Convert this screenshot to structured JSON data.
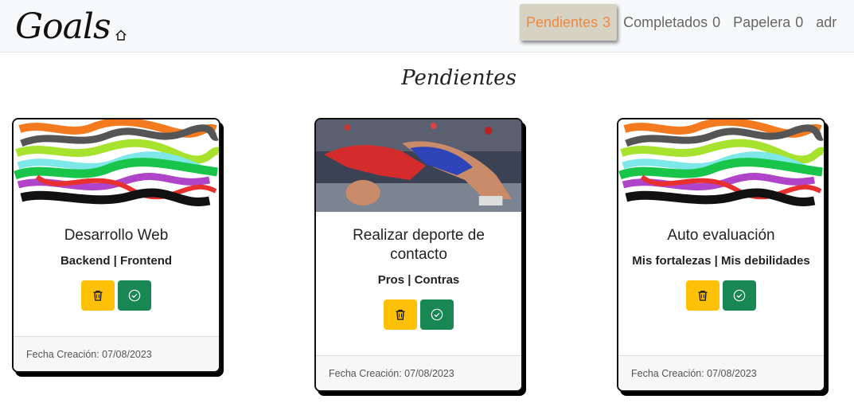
{
  "navbar": {
    "brand": "Goals",
    "links": [
      {
        "label": "Pendientes",
        "count": "3",
        "active": true
      },
      {
        "label": "Completados",
        "count": "0",
        "active": false
      },
      {
        "label": "Papelera",
        "count": "0",
        "active": false
      },
      {
        "label": "adr",
        "count": "",
        "active": false
      }
    ]
  },
  "section_title": "Pendientes",
  "cards": [
    {
      "title": "Desarrollo Web",
      "subtitle": "Backend | Frontend",
      "date": "Fecha Creación: 07/08/2023",
      "image": "colorful-scribbles"
    },
    {
      "title": "Realizar deporte de contacto",
      "subtitle": "Pros | Contras",
      "date": "Fecha Creación: 07/08/2023",
      "image": "wrestling-photo"
    },
    {
      "title": "Auto evaluación",
      "subtitle": "Mis fortalezas | Mis debilidades",
      "date": "Fecha Creación: 07/08/2023",
      "image": "colorful-scribbles"
    }
  ],
  "colors": {
    "delete": "#ffc107",
    "complete": "#198754",
    "active_nav_text": "#f0883e"
  },
  "icons": {
    "brand": "home-icon",
    "delete": "trash-icon",
    "complete": "check-circle-icon"
  }
}
